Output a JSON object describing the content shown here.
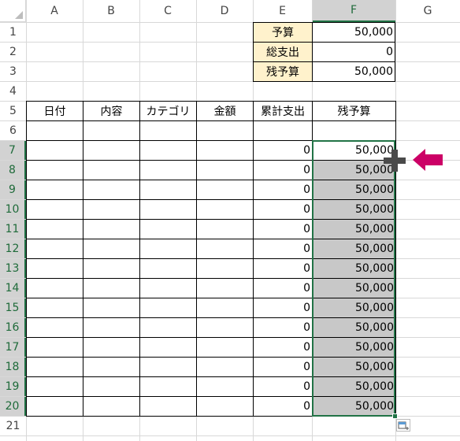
{
  "columns": [
    "A",
    "B",
    "C",
    "D",
    "E",
    "F",
    "G"
  ],
  "rows": [
    "1",
    "2",
    "3",
    "4",
    "5",
    "6",
    "7",
    "8",
    "9",
    "10",
    "11",
    "12",
    "13",
    "14",
    "15",
    "16",
    "17",
    "18",
    "19",
    "20",
    "21"
  ],
  "selected_column": "F",
  "selected_rows_from": 7,
  "selected_rows_to": 20,
  "summary": {
    "budget_label": "予算",
    "budget_value": "50,000",
    "total_expense_label": "総支出",
    "total_expense_value": "0",
    "remaining_label": "残予算",
    "remaining_value": "50,000"
  },
  "table_headers": [
    "日付",
    "内容",
    "カテゴリ",
    "金額",
    "累計支出",
    "残予算"
  ],
  "table_rows": [
    {
      "cumulative": "0",
      "remaining": "50,000"
    },
    {
      "cumulative": "0",
      "remaining": "50,000"
    },
    {
      "cumulative": "0",
      "remaining": "50,000"
    },
    {
      "cumulative": "0",
      "remaining": "50,000"
    },
    {
      "cumulative": "0",
      "remaining": "50,000"
    },
    {
      "cumulative": "0",
      "remaining": "50,000"
    },
    {
      "cumulative": "0",
      "remaining": "50,000"
    },
    {
      "cumulative": "0",
      "remaining": "50,000"
    },
    {
      "cumulative": "0",
      "remaining": "50,000"
    },
    {
      "cumulative": "0",
      "remaining": "50,000"
    },
    {
      "cumulative": "0",
      "remaining": "50,000"
    },
    {
      "cumulative": "0",
      "remaining": "50,000"
    },
    {
      "cumulative": "0",
      "remaining": "50,000"
    },
    {
      "cumulative": "0",
      "remaining": "50,000"
    }
  ],
  "colors": {
    "accent_green": "#217346",
    "arrow_magenta": "#cc0066",
    "summary_fill": "#fff2cc",
    "fill_gray": "#c8c8c8"
  },
  "icons": {
    "fill_handle_cursor": "plus-cross-icon",
    "pointer_arrow": "left-arrow-icon",
    "autofill_options": "autofill-options-icon"
  }
}
